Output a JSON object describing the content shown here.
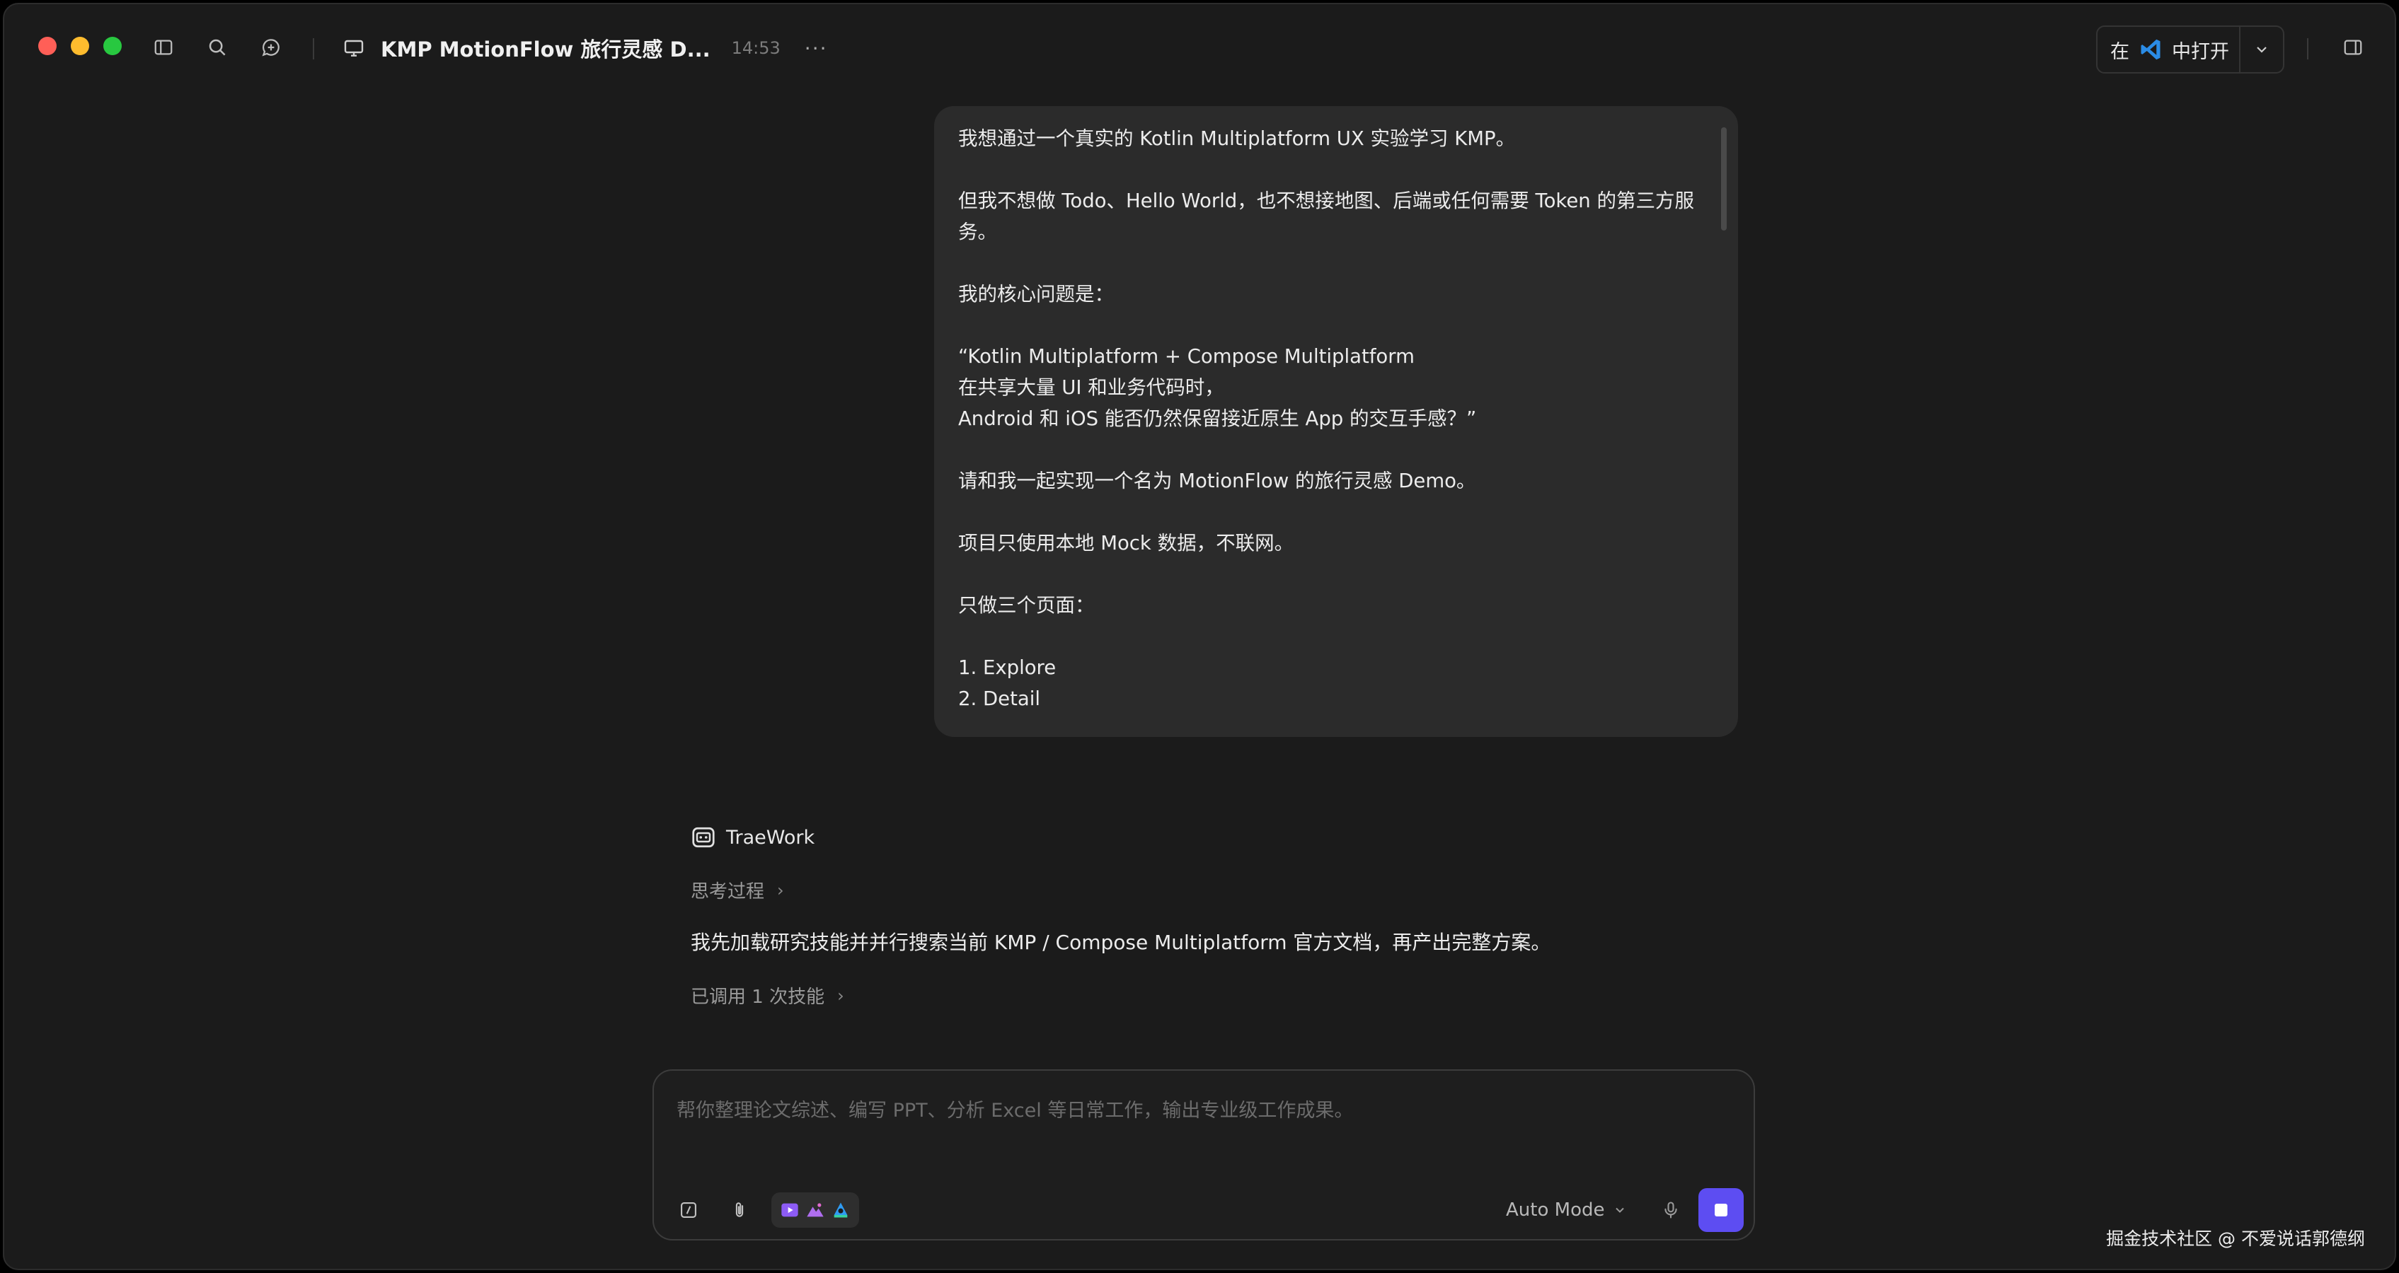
{
  "window": {
    "title": "KMP MotionFlow 旅行灵感 D...",
    "time": "14:53",
    "more": "···"
  },
  "open_in": {
    "prefix": "在",
    "label": "中打开",
    "editor_icon": "vscode-icon"
  },
  "user_message": {
    "paragraphs": [
      [
        "我想通过一个真实的 Kotlin Multiplatform UX 实验学习 KMP。"
      ],
      [
        "但我不想做 Todo、Hello World，也不想接地图、后端或任何需要 Token 的第三方服",
        "务。"
      ],
      [
        "我的核心问题是："
      ],
      [
        "“Kotlin Multiplatform + Compose Multiplatform",
        "在共享大量 UI 和业务代码时，",
        "Android 和 iOS 能否仍然保留接近原生 App 的交互手感？”"
      ],
      [
        "请和我一起实现一个名为 MotionFlow 的旅行灵感 Demo。"
      ],
      [
        "项目只使用本地 Mock 数据，不联网。"
      ],
      [
        "只做三个页面："
      ],
      [
        "1. Explore",
        "2. Detail"
      ]
    ]
  },
  "assistant": {
    "name": "TraeWork",
    "thinking_label": "思考过程",
    "answer": "我先加载研究技能并并行搜索当前 KMP / Compose Multiplatform 官方文档，再产出完整方案。",
    "skills_label": "已调用 1 次技能"
  },
  "composer": {
    "placeholder": "帮你整理论文综述、编写 PPT、分析 Excel 等日常工作，输出专业级工作成果。",
    "mode": "Auto Mode"
  },
  "watermark": "掘金技术社区 @ 不爱说话郭德纲",
  "colors": {
    "accent": "#5d4df2",
    "bubble": "#2b2b2b",
    "background": "#1b1b1b"
  }
}
